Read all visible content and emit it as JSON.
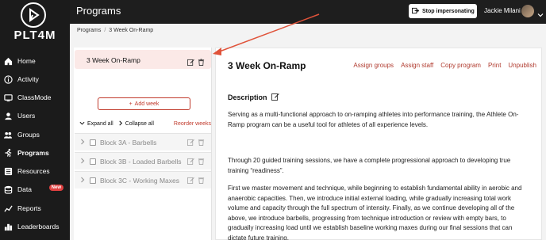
{
  "brand": {
    "logo_text": "PLT4M"
  },
  "sidebar": {
    "items": [
      {
        "label": "Home",
        "icon": "home-icon"
      },
      {
        "label": "Activity",
        "icon": "info-icon"
      },
      {
        "label": "ClassMode",
        "icon": "classmode-icon"
      },
      {
        "label": "Users",
        "icon": "users-icon"
      },
      {
        "label": "Groups",
        "icon": "groups-icon"
      },
      {
        "label": "Programs",
        "icon": "runner-icon",
        "active": true
      },
      {
        "label": "Resources",
        "icon": "resources-icon"
      },
      {
        "label": "Data",
        "icon": "database-icon",
        "badge": "New"
      },
      {
        "label": "Reports",
        "icon": "reports-icon"
      },
      {
        "label": "Leaderboards",
        "icon": "leaderboards-icon"
      }
    ]
  },
  "topbar": {
    "title": "Programs",
    "impersonate_label": "Stop impersonating",
    "user_name": "Jackie Milani"
  },
  "breadcrumb": {
    "root": "Programs",
    "current": "3 Week On-Ramp"
  },
  "program_list": {
    "title": "3 Week On-Ramp",
    "add_week_label": "Add week",
    "expand_all_label": "Expand all",
    "collapse_all_label": "Collapse all",
    "reorder_label": "Reorder weeks",
    "blocks": [
      {
        "label": "Block 3A - Barbells"
      },
      {
        "label": "Block 3B - Loaded Barbells"
      },
      {
        "label": "Block 3C - Working Maxes"
      }
    ]
  },
  "detail": {
    "title": "3 Week On-Ramp",
    "actions": [
      "Assign groups",
      "Assign staff",
      "Copy program",
      "Print",
      "Unpublish"
    ],
    "description_label": "Description",
    "paragraphs": [
      "Serving as a multi-functional approach to on-ramping athletes into performance training, the Athlete On-Ramp program can be a useful tool for athletes of all experience levels.",
      "Through 20 guided training sessions, we have a complete progressional approach to developing true training “readiness”.",
      "First we master movement and technique, while beginning to establish fundamental ability in aerobic and anaerobic capacities. Then, we introduce initial external loading, while gradually increasing total work volume and capacity through the full spectrum of intensity. Finally, as we continue developing all of the above, we introduce barbells, progressing from technique introduction or review with empty bars, to gradually increasing load until we establish baseline working maxes during our final sessions that can dictate future training."
    ]
  },
  "colors": {
    "accent": "#c0392b",
    "sidebar_bg": "#1b1b1b",
    "highlight_bg": "#fbe9e7"
  }
}
